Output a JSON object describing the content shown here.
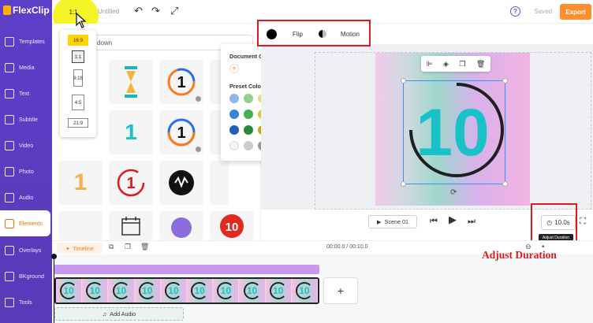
{
  "app": {
    "logo_text": "FlexClip",
    "title": "Untitled"
  },
  "toolbar": {
    "ratio_label": "1:1",
    "undo_glyph": "↶",
    "redo_glyph": "↷",
    "fullscreen_glyph": "⤢",
    "help_glyph": "?",
    "saved_label": "Saved",
    "export_label": "Export"
  },
  "sidebar": {
    "items": [
      {
        "label": "Templates",
        "icon": "templates-icon"
      },
      {
        "label": "Media",
        "icon": "media-icon"
      },
      {
        "label": "Text",
        "icon": "text-icon"
      },
      {
        "label": "Subtitle",
        "icon": "subtitle-icon"
      },
      {
        "label": "Video",
        "icon": "video-icon"
      },
      {
        "label": "Photo",
        "icon": "photo-icon"
      },
      {
        "label": "Audio",
        "icon": "audio-icon"
      },
      {
        "label": "Elements",
        "icon": "elements-icon",
        "active": true
      },
      {
        "label": "Overlays",
        "icon": "overlays-icon"
      },
      {
        "label": "BKground",
        "icon": "background-icon"
      },
      {
        "label": "Tools",
        "icon": "tools-icon"
      }
    ]
  },
  "panel": {
    "dropdown_label": "down"
  },
  "ratio_menu": {
    "options": [
      "16:9",
      "1:1",
      "9:16",
      "4:5",
      "21:9"
    ],
    "selected": "1:1"
  },
  "element_toolbar": {
    "flip_label": "Flip",
    "motion_label": "Motion"
  },
  "color_popover": {
    "document_title": "Document Colors",
    "preset_title": "Preset Colors",
    "swatches": [
      [
        "#8fb8e8",
        "#94d08f",
        "#e8dc8a",
        "#f2c08d",
        "#f2a0a0",
        "#b8a0e0"
      ],
      [
        "#3a86d6",
        "#44b056",
        "#e2c63a",
        "#f29b3a",
        "#e84a4a",
        "#8a56d0"
      ],
      [
        "#1f5fb8",
        "#2b8a3a",
        "#c9a318",
        "#e27a12",
        "#c81e1e",
        "#5e2fb0"
      ],
      [
        "#f5f5f5",
        "#cccccc",
        "#999999",
        "#666666",
        "#333333",
        "#000000"
      ]
    ]
  },
  "canvas": {
    "number": "10"
  },
  "playback": {
    "scene_label": "Scene 01",
    "duration_label": "10.0s",
    "tooltip": "Adjust Duration"
  },
  "timeline": {
    "tab_label": "Timeline",
    "time_label": "00:00.0 / 00:10.0",
    "thumb_number": "10",
    "thumb_count": 10,
    "add_audio_label": "Add Audio",
    "add_glyph": "+"
  },
  "annotation": {
    "text": "Adjust Duration"
  },
  "colors": {
    "accent": "#ff8f2d",
    "nav_bg": "#5d3ec9",
    "highlight": "#e0191f",
    "number": "#19c2c9"
  }
}
